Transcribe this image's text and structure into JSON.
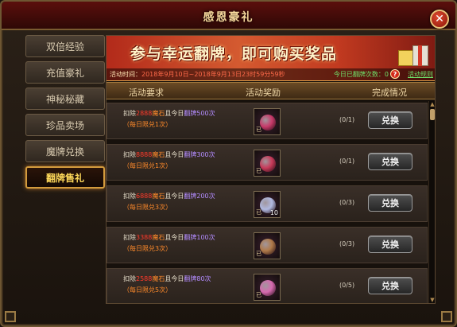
{
  "window": {
    "title": "感恩豪礼"
  },
  "sidebar": {
    "items": [
      {
        "label": "双倍经验",
        "active": false
      },
      {
        "label": "充值豪礼",
        "active": false
      },
      {
        "label": "神秘秘藏",
        "active": false
      },
      {
        "label": "珍品卖场",
        "active": false
      },
      {
        "label": "魔牌兑换",
        "active": false
      },
      {
        "label": "翻牌售礼",
        "active": true
      }
    ]
  },
  "banner": {
    "headline": "参与幸运翻牌，即可购买奖品",
    "time_label": "活动时间：",
    "time_value": "2018年9月10日~2018年9月13日23时59分59秒",
    "flip_count": "今日已翻牌次数：0",
    "rules_link": "活动规则"
  },
  "table": {
    "headers": {
      "requirement": "活动要求",
      "reward": "活动奖励",
      "status": "完成情况"
    },
    "rows": [
      {
        "prefix": "扣除",
        "amount": "2888",
        "currency": "魔石",
        "middle": "且今日",
        "flip": "翻牌500次",
        "limit": "（每日限兑1次）",
        "item": "crimson-orb-icon",
        "item_color": "#c83a6a",
        "bind": "已",
        "qty": "",
        "progress": "(0/1)",
        "button": "兑换"
      },
      {
        "prefix": "扣除",
        "amount": "8888",
        "currency": "魔石",
        "middle": "且今日",
        "flip": "翻牌300次",
        "limit": "（每日限兑1次）",
        "item": "crimson-orb-icon",
        "item_color": "#c83a5a",
        "bind": "已",
        "qty": "",
        "progress": "(0/1)",
        "button": "兑换"
      },
      {
        "prefix": "扣除",
        "amount": "6888",
        "currency": "魔石",
        "middle": "且今日",
        "flip": "翻牌200次",
        "limit": "（每日限兑3次）",
        "item": "silver-potion-icon",
        "item_color": "#b0b8e0",
        "bind": "已",
        "qty": "10",
        "progress": "(0/3)",
        "button": "兑换"
      },
      {
        "prefix": "扣除",
        "amount": "3388",
        "currency": "魔石",
        "middle": "且今日",
        "flip": "翻牌100次",
        "limit": "（每日限兑3次）",
        "item": "bronze-scroll-icon",
        "item_color": "#b07a4a",
        "bind": "已",
        "qty": "",
        "progress": "(0/3)",
        "button": "兑换"
      },
      {
        "prefix": "扣除",
        "amount": "2588",
        "currency": "魔石",
        "middle": "且今日",
        "flip": "翻牌80次",
        "limit": "（每日限兑5次）",
        "item": "rose-gem-icon",
        "item_color": "#d66ab0",
        "bind": "已",
        "qty": "",
        "progress": "(0/5)",
        "button": "兑换"
      }
    ]
  },
  "icons": {
    "close": "close-icon",
    "help": "help-icon",
    "gift": "gift-box-icon"
  }
}
